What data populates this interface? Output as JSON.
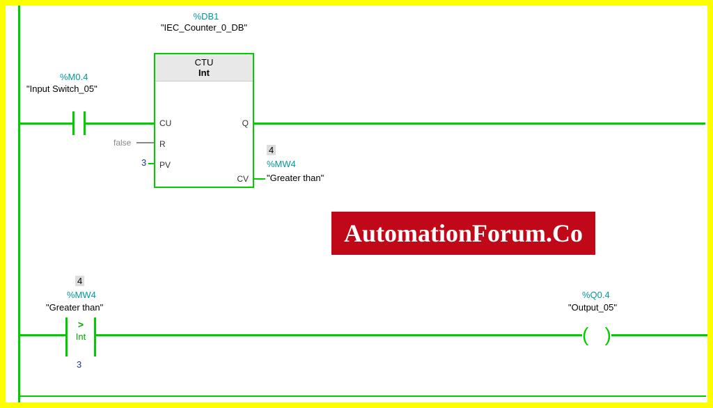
{
  "db": {
    "addr": "%DB1",
    "name": "\"IEC_Counter_0_DB\""
  },
  "input": {
    "addr": "%M0.4",
    "name": "\"Input Switch_05\""
  },
  "ctu": {
    "title": "CTU",
    "type": "Int",
    "pins": {
      "cu": "CU",
      "r": "R",
      "pv": "PV",
      "q": "Q",
      "cv": "CV"
    },
    "r_val": "false",
    "pv_val": "3"
  },
  "cv_out": {
    "addr": "%MW4",
    "name": "\"Greater than\"",
    "val": "4"
  },
  "rung2": {
    "compare": {
      "addr": "%MW4",
      "name": "\"Greater than\"",
      "val": "4",
      "op": ">",
      "type": "Int",
      "const": "3"
    },
    "output": {
      "addr": "%Q0.4",
      "name": "\"Output_05\""
    }
  },
  "watermark": "AutomationForum.Co"
}
